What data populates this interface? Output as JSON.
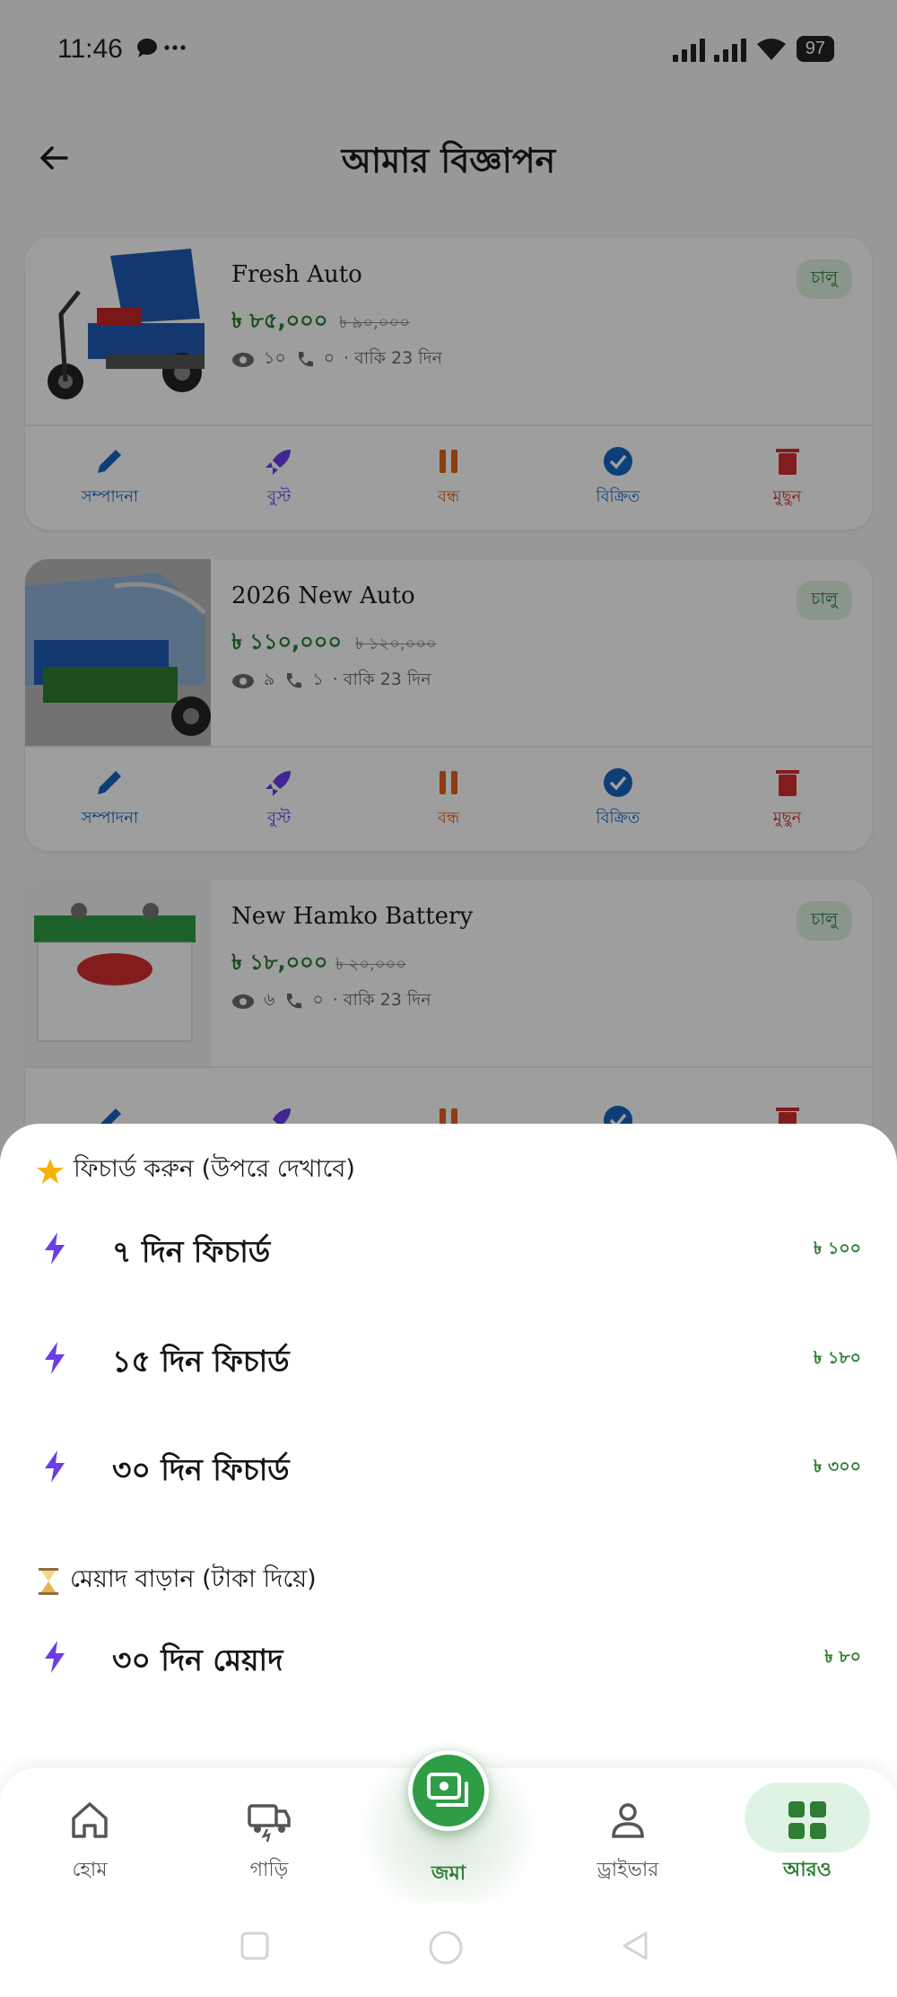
{
  "status_bar": {
    "time": "11:46",
    "notif_icons": "…",
    "battery": "97"
  },
  "header": {
    "title": "আমার বিজ্ঞাপন"
  },
  "ads": [
    {
      "title": "Fresh Auto",
      "price": "৳ ৮৫,০০০",
      "old_price": "৳ ৯০,০০০",
      "views": "১০",
      "calls": "০",
      "remaining": "· বাকি 23 দিন",
      "status": "চালু"
    },
    {
      "title": "2026 New Auto",
      "price": "৳ ১১০,০০০",
      "old_price": "৳ ১২০,০০০",
      "views": "৯",
      "calls": "১",
      "remaining": "· বাকি 23 দিন",
      "status": "চালু"
    },
    {
      "title": "New Hamko Battery",
      "price": "৳ ১৮,০০০",
      "old_price": "৳ ২০,০০০",
      "views": "৬",
      "calls": "০",
      "remaining": "· বাকি 23 দিন",
      "status": "চালু"
    }
  ],
  "ad_actions": {
    "edit": "সম্পাদনা",
    "boost": "বুস্ট",
    "pause": "বন্ধ",
    "sold": "বিক্রিত",
    "delete": "মুছুন"
  },
  "sheet": {
    "featured_heading": "ফিচার্ড করুন (উপরে দেখাবে)",
    "featured_options": [
      {
        "label": "৭ দিন ফিচার্ড",
        "price": "৳ ১০০"
      },
      {
        "label": "১৫ দিন ফিচার্ড",
        "price": "৳ ১৮০"
      },
      {
        "label": "৩০ দিন ফিচার্ড",
        "price": "৳ ৩০০"
      }
    ],
    "extend_heading": "মেয়াদ বাড়ান (টাকা দিয়ে)",
    "extend_options": [
      {
        "label": "৩০ দিন মেয়াদ",
        "price": "৳ ৮০"
      }
    ]
  },
  "bottom_nav": {
    "home": "হোম",
    "vehicle": "গাড়ি",
    "deposit": "জমা",
    "driver": "ড্রাইভার",
    "more": "আরও"
  },
  "colors": {
    "accent_green": "#2e7d32",
    "boost_purple": "#6a3de8",
    "pause_orange": "#e0621c",
    "sold_blue": "#1565c0",
    "delete_red": "#d32f2f"
  }
}
